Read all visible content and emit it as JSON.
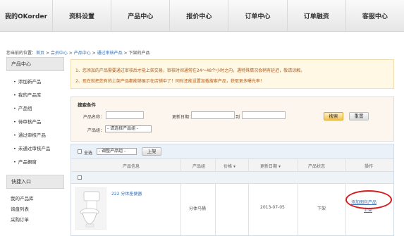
{
  "nav": [
    "我的OKorder",
    "资料设置",
    "产品中心",
    "报价中心",
    "订单中心",
    "订单融资",
    "客服中心"
  ],
  "breadcrumb": {
    "prefix": "您当前的位置：",
    "home": "首页",
    "member": "会员中心",
    "products": "产品中心",
    "approved": "通过审核产品",
    "current": "下架的产品"
  },
  "sidebar": {
    "header": "产品中心",
    "items": [
      "添加新产品",
      "我的产品库",
      "产品组",
      "待审核产品",
      "通过审核产品",
      "未通过审核产品",
      "产品橱窗"
    ],
    "quick_header": "快捷入口",
    "quick_items": [
      "我的产品库",
      "询盘列表",
      "采购订单"
    ]
  },
  "notice": {
    "line1": "1、您添加的产品需要通过审核后才能上架交易，审核时间通常在24～48个小时之内，遇特殊情况会稍有延迟，敬请谅解。",
    "line2": "2、现在就把您有的上架产品都能够展示在店铺中了！同时还能设置加载搜索产品，获取更多曝光率！"
  },
  "search": {
    "title": "搜索条件",
    "name_label": "产品名称：",
    "date_label": "更新日期：",
    "to_label": "到",
    "group_label": "产品组：",
    "group_select": "- 请选择产品组 -",
    "search_button": "搜索",
    "reset_button": "重置"
  },
  "toolbar": {
    "select_all": "全选",
    "adjust_select": "- 调整产品组 -",
    "list_button": "上架"
  },
  "table": {
    "headers": [
      "产品信息",
      "产品组",
      "价格",
      "更新日期",
      "产品状态",
      "操作"
    ],
    "rows": [
      {
        "name": "222 分体座便器",
        "group": "分体马桶",
        "price": "",
        "date": "2013-07-05",
        "status": "下架",
        "action": "添加图包产品",
        "action2": "上架"
      }
    ]
  },
  "colors": {
    "nav_bg": "#e6e6e6",
    "link": "#3a6fb0",
    "notice_text": "#b05a1a",
    "highlight_ring": "#d71a1a"
  }
}
